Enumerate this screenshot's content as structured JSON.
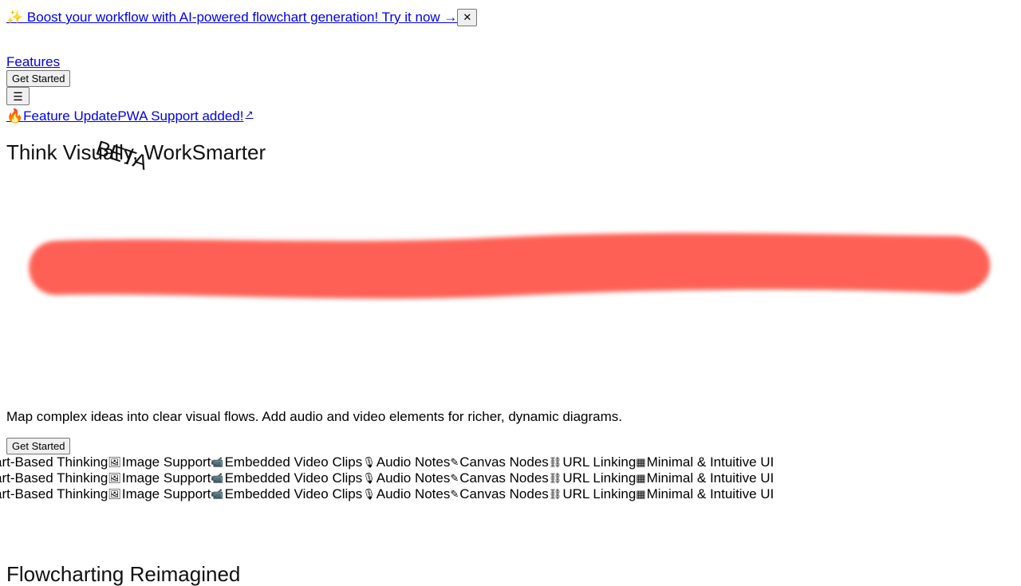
{
  "promo": {
    "icon": "sparkles-icon",
    "sparkle_glyph": "✨",
    "text": " Boost your workflow with AI-powered flowchart generation! Try it now →",
    "close_label": "✕"
  },
  "nav": {
    "features_label": "Features",
    "get_started_label": "Get Started",
    "menu_glyph": "☰"
  },
  "update": {
    "fire_glyph": "🔥",
    "tag": " Feature Update",
    "text": "PWA Support added!",
    "external_glyph": "↗"
  },
  "hero": {
    "title": "Think Visually, Work Smarter",
    "title_part1": "Think Visually, ",
    "title_part2": "Work",
    "title_part3": "Smarter",
    "beta": "BETA",
    "brush_color": "#ff6154",
    "description": "Map complex ideas into clear visual flows. Add audio and video elements for richer, dynamic diagrams.",
    "cta_label": "Get Started"
  },
  "marquee": {
    "items": [
      {
        "icon": "flowchart-icon",
        "glyph": "",
        "label": "art-Based Thinking"
      },
      {
        "icon": "image-icon",
        "glyph": "🖼",
        "label": "Image Support"
      },
      {
        "icon": "video-icon",
        "glyph": "📹",
        "label": "Embedded Video Clips"
      },
      {
        "icon": "microphone-icon",
        "glyph": "🎙",
        "label": "Audio Notes"
      },
      {
        "icon": "canvas-icon",
        "glyph": "✎",
        "label": "Canvas Nodes"
      },
      {
        "icon": "link-icon",
        "glyph": "⛓",
        "label": "URL Linking"
      },
      {
        "icon": "grid-icon",
        "glyph": "▦",
        "label": "Minimal & Intuitive UI"
      }
    ]
  },
  "section": {
    "title": "Flowcharting Reimagined"
  }
}
